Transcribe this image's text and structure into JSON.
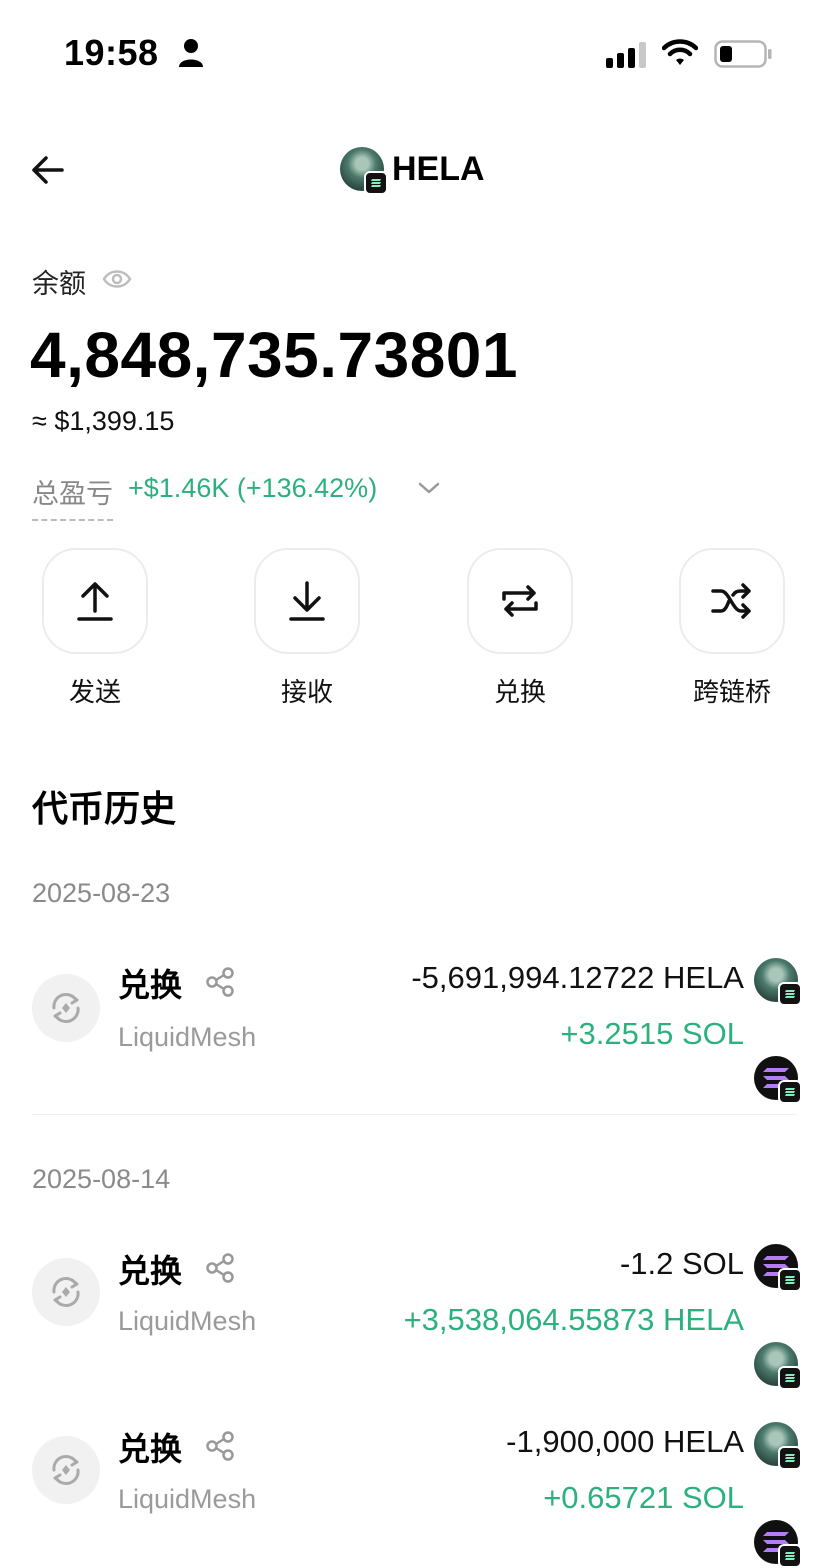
{
  "status_bar": {
    "time": "19:58"
  },
  "header": {
    "title": "HELA",
    "token_icon": "hela-token-icon"
  },
  "balance": {
    "label": "余额",
    "value": "4,848,735.73801",
    "usd": "≈ $1,399.15",
    "pnl_label": "总盈亏",
    "pnl_value": "+$1.46K (+136.42%)"
  },
  "actions": [
    {
      "label": "发送",
      "icon": "upload-icon"
    },
    {
      "label": "接收",
      "icon": "download-icon"
    },
    {
      "label": "兑换",
      "icon": "swap-icon"
    },
    {
      "label": "跨链桥",
      "icon": "shuffle-icon"
    }
  ],
  "history": {
    "title": "代币历史",
    "groups": [
      {
        "date": "2025-08-23",
        "items": [
          {
            "type": "兑换",
            "source": "LiquidMesh",
            "out": "-5,691,994.12722 HELA",
            "in": "+3.2515 SOL"
          }
        ]
      },
      {
        "date": "2025-08-14",
        "items": [
          {
            "type": "兑换",
            "source": "LiquidMesh",
            "out": "-1.2 SOL",
            "in": "+3,538,064.55873 HELA"
          },
          {
            "type": "兑换",
            "source": "LiquidMesh",
            "out": "-1,900,000 HELA",
            "in": "+0.65721 SOL"
          }
        ]
      }
    ]
  },
  "colors": {
    "positive": "#2cb17e",
    "muted": "#8a8a8a"
  }
}
